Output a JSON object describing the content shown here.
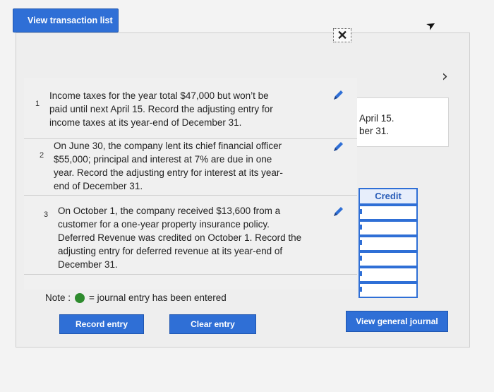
{
  "top_button": {
    "label": "View transaction list"
  },
  "close": {
    "glyph": "✕"
  },
  "nav": {
    "next_glyph": "›"
  },
  "date_box": {
    "line1": "April 15.",
    "line2": "ber 31."
  },
  "credit": {
    "header": "Credit",
    "rows": 6
  },
  "transactions": [
    {
      "number": "1",
      "lines": [
        "Income taxes for the year total $47,000 but won’t be",
        "paid until next April 15. Record the adjusting entry for",
        "income taxes at its year-end of December 31."
      ]
    },
    {
      "number": "2",
      "lines": [
        "On June 30, the company lent its chief financial officer",
        "$55,000; principal and interest at 7% are due in one",
        "year. Record the adjusting entry for interest at its year-",
        "end of December 31."
      ]
    },
    {
      "number": "3",
      "lines": [
        "On October 1, the company received $13,600 from a",
        "customer for a one-year property insurance policy.",
        "Deferred Revenue was credited on October 1. Record the",
        "adjusting entry for deferred revenue at its year-end of",
        "December 31."
      ]
    }
  ],
  "note": {
    "prefix": "Note :",
    "suffix": "= journal entry has been entered"
  },
  "buttons": {
    "record": "Record entry",
    "clear": "Clear entry",
    "general_journal": "View general journal"
  },
  "colors": {
    "accent": "#2f6fd6",
    "entered_dot": "#2e8b2e"
  }
}
